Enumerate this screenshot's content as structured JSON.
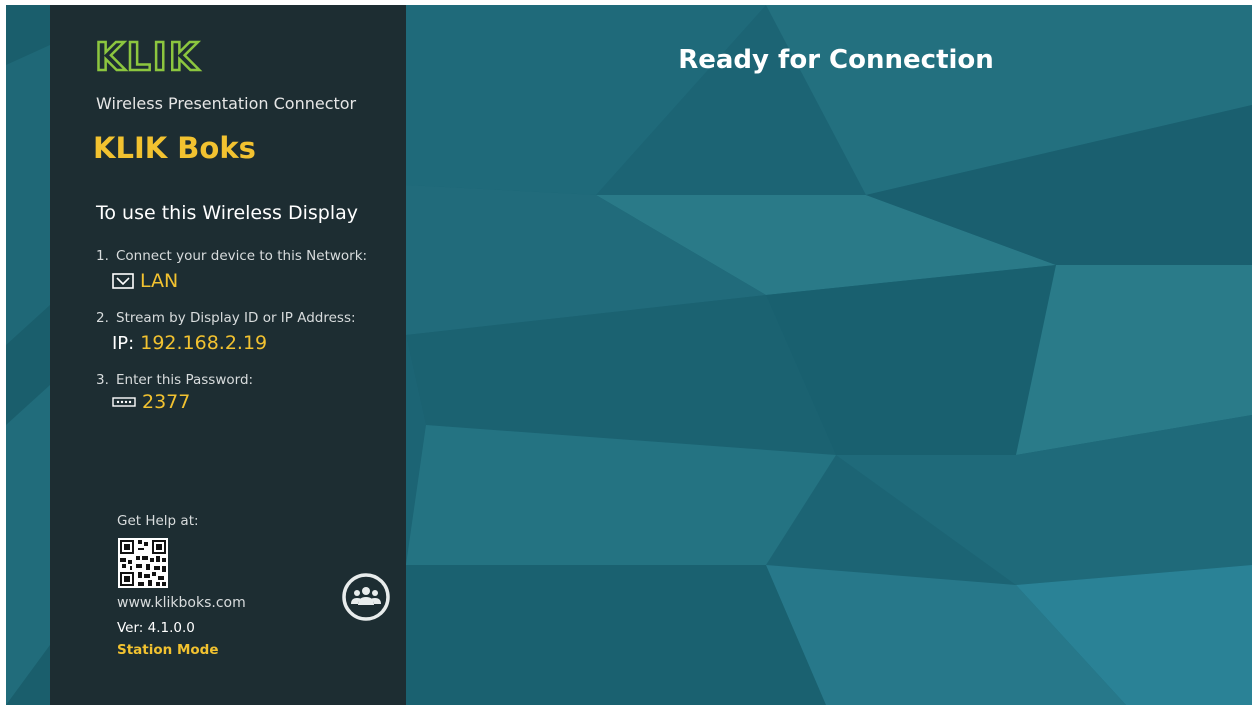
{
  "brand": {
    "logo_text": "KLIK",
    "subtitle": "Wireless Presentation Connector"
  },
  "device": {
    "name": "KLIK Boks"
  },
  "instructions": {
    "title": "To use this Wireless Display",
    "steps": [
      {
        "num": "1.",
        "label": "Connect your device to this Network:",
        "value": "LAN",
        "icon": "lan-icon"
      },
      {
        "num": "2.",
        "label": "Stream by Display ID or IP Address:",
        "prefix": "IP:",
        "value": "192.168.2.19"
      },
      {
        "num": "3.",
        "label": "Enter this Password:",
        "value": "2377",
        "icon": "password-icon"
      }
    ]
  },
  "help": {
    "label": "Get Help at:",
    "url": "www.klikboks.com",
    "version": "Ver: 4.1.0.0",
    "mode": "Station Mode"
  },
  "main": {
    "status": "Ready for Connection"
  },
  "colors": {
    "accent": "#f2c230",
    "logo_green": "#8cc63f",
    "sidebar_bg": "#1d2d32",
    "main_bg": "#1d6575"
  },
  "icons": {
    "users": "users-icon",
    "qr": "qr-code"
  }
}
